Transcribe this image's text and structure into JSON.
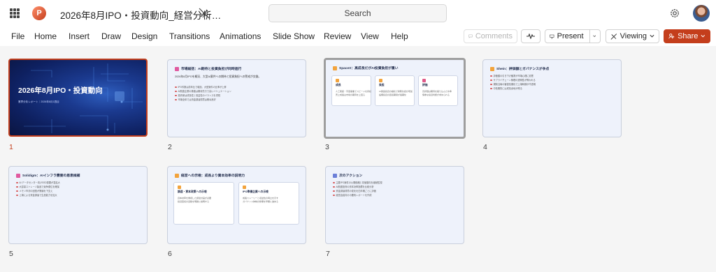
{
  "app": {
    "logo_letter": "P",
    "doc_title": "2026年8月IPO・投資動向_経営分析…"
  },
  "search": {
    "placeholder": "Search"
  },
  "menu": [
    "File",
    "Home",
    "Insert",
    "Draw",
    "Design",
    "Transitions",
    "Animations",
    "Slide Show",
    "Review",
    "View",
    "Help"
  ],
  "toolbar": {
    "comments": "Comments",
    "present": "Present",
    "viewing": "Viewing",
    "share": "Share"
  },
  "slides": [
    {
      "num": "1",
      "title": "2026年8月IPO・投資動向",
      "sub": "業界分析レポート｜2026年8月1週目"
    },
    {
      "num": "2",
      "title": "市場総括：AI期待と投資負担が同時進行",
      "sub": "2026年8月IPOを概況、大型AI案件への期待と投資負担への警戒が交錯。",
      "bullets": [
        "IPO件数は前年比で増加、大型案件の比率が上昇",
        "AI関連企業の株価は期待先行で高いバリュエーション",
        "投資家は成長性と収益性のバランスを重視",
        "市場全体では資金調達環境は概ね良好"
      ]
    },
    {
      "num": "3",
      "title": "SpaceX：高成長だがAI投資負担が重い",
      "cards": [
        {
          "title": "成長",
          "lines": [
            "人工衛星・宇宙事業でスピードを持続",
            "売上成長は市場の期待を上回る"
          ]
        },
        {
          "title": "負担",
          "lines": [
            "AI関連投資の継続で財務負担が増加",
            "設備投資の回収期間が長期化"
          ]
        },
        {
          "title": "評価",
          "lines": [
            "高評価は期待を織り込んだ水準",
            "慎重な投資判断が求められる"
          ]
        }
      ]
    },
    {
      "num": "4",
      "title": "Shein：評価額とガバナンスが争点",
      "bullets": [
        "評価額の引き下げ観測が市場心理に影響",
        "サプライチェーン管理の透明性が問われる",
        "規制当局の審査長期化で上場時期が不透明",
        "中長期的には成長余地が残る"
      ]
    },
    {
      "num": "5",
      "title": "Solidigm：AIインフラ需要の恩恵候補",
      "bullets": [
        "AI データセンター向けSSD需要が急拡大",
        "大容量ストレージ製品で競争優位を確保",
        "メモリ市況の回復が業績を下支え",
        "上場による資金調達で生産能力を拡大"
      ]
    },
    {
      "num": "6",
      "title": "経営への示唆：成長より資本効率の説明力",
      "cards": [
        {
          "title": "調達・資本政策への示唆",
          "lines": [
            "資本効率を重視した調達計画が必要",
            "投資回収の道筋を明確に説明する"
          ]
        },
        {
          "title": "IPO準備企業への示唆",
          "lines": [
            "成長ストーリーと収益性の両立を示す",
            "ガバナンス体制の整備を早期に進める"
          ]
        }
      ]
    },
    {
      "num": "7",
      "title": "次のアクション",
      "bullets": [
        "主要IPO案件の公開価格と初値動向を継続監視",
        "AI関連投資の資本効率指標を比較分析",
        "資金調達環境の変化を四半期ごとに評価",
        "経営会議向けの要約レポートを作成"
      ]
    }
  ],
  "colors": {
    "accent": "#c43e1c",
    "slide_bg": "#eef2fb"
  }
}
